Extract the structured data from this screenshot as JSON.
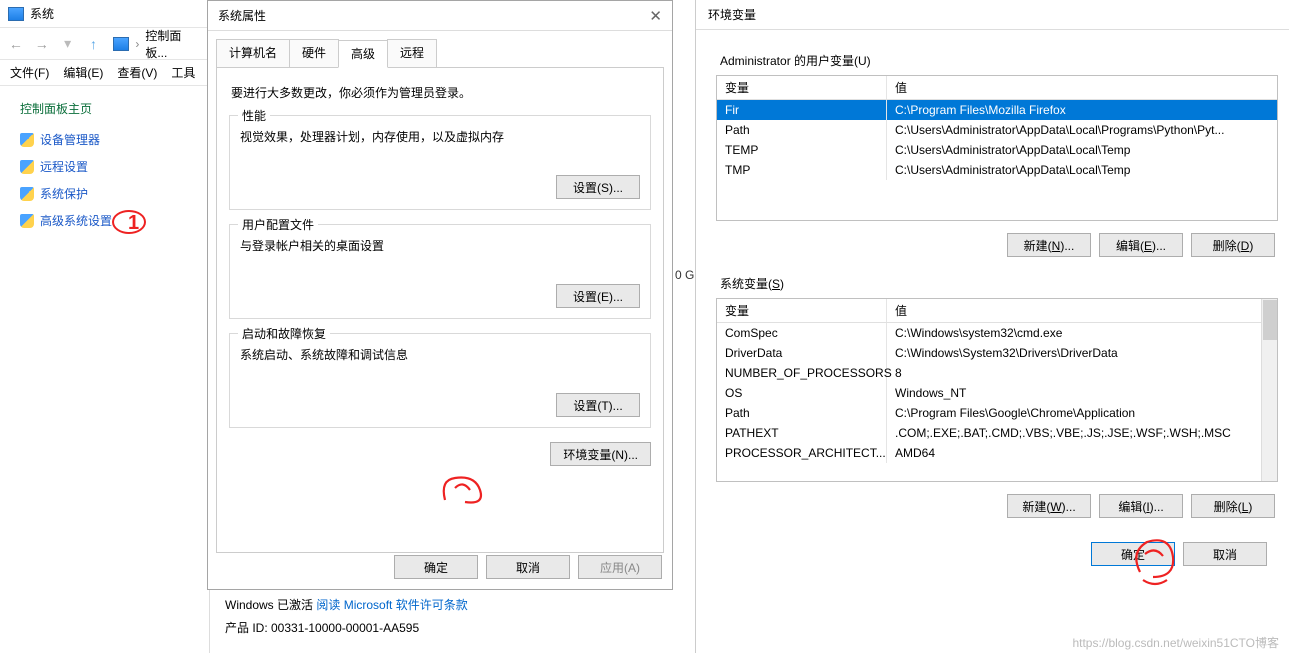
{
  "explorer": {
    "title": "系统",
    "breadcrumb": "控制面板...",
    "menu": [
      "文件(F)",
      "编辑(E)",
      "查看(V)",
      "工具"
    ],
    "side_title": "控制面板主页",
    "links": [
      "设备管理器",
      "远程设置",
      "系统保护",
      "高级系统设置"
    ],
    "annotation1": "1"
  },
  "props": {
    "title": "系统属性",
    "tabs": [
      "计算机名",
      "硬件",
      "高级",
      "远程"
    ],
    "statement": "要进行大多数更改，你必须作为管理员登录。",
    "perf": {
      "title": "性能",
      "desc": "视觉效果，处理器计划，内存使用，以及虚拟内存",
      "btn": "设置(S)..."
    },
    "profile": {
      "title": "用户配置文件",
      "desc": "与登录帐户相关的桌面设置",
      "btn": "设置(E)..."
    },
    "startup": {
      "title": "启动和故障恢复",
      "desc": "系统启动、系统故障和调试信息",
      "btn": "设置(T)..."
    },
    "envbtn": "环境变量(N)...",
    "ok": "确定",
    "cancel": "取消",
    "apply": "应用(A)",
    "activation_prefix": "Windows 已激活 ",
    "activation_link": "阅读 Microsoft 软件许可条款",
    "product_id": "产品 ID: 00331-10000-00001-AA595"
  },
  "env": {
    "title": "环境变量",
    "user_section": "Administrator 的用户变量(U)",
    "col_var": "变量",
    "col_val": "值",
    "user_vars": [
      {
        "k": "Fir",
        "v": "C:\\Program Files\\Mozilla Firefox"
      },
      {
        "k": "Path",
        "v": "C:\\Users\\Administrator\\AppData\\Local\\Programs\\Python\\Pyt..."
      },
      {
        "k": "TEMP",
        "v": "C:\\Users\\Administrator\\AppData\\Local\\Temp"
      },
      {
        "k": "TMP",
        "v": "C:\\Users\\Administrator\\AppData\\Local\\Temp"
      }
    ],
    "sys_section": "系统变量(S)",
    "sys_vars": [
      {
        "k": "ComSpec",
        "v": "C:\\Windows\\system32\\cmd.exe"
      },
      {
        "k": "DriverData",
        "v": "C:\\Windows\\System32\\Drivers\\DriverData"
      },
      {
        "k": "NUMBER_OF_PROCESSORS",
        "v": "8"
      },
      {
        "k": "OS",
        "v": "Windows_NT"
      },
      {
        "k": "Path",
        "v": "C:\\Program Files\\Google\\Chrome\\Application"
      },
      {
        "k": "PATHEXT",
        "v": ".COM;.EXE;.BAT;.CMD;.VBS;.VBE;.JS;.JSE;.WSF;.WSH;.MSC"
      },
      {
        "k": "PROCESSOR_ARCHITECT...",
        "v": "AMD64"
      }
    ],
    "new": "新建(N)...",
    "edit": "编辑(E)...",
    "del": "删除(D)",
    "new2": "新建(W)...",
    "edit2": "编辑(I)...",
    "del2": "删除(L)",
    "ok": "确定",
    "cancel": "取消",
    "annotation3": "3"
  },
  "peek": "0 G"
}
